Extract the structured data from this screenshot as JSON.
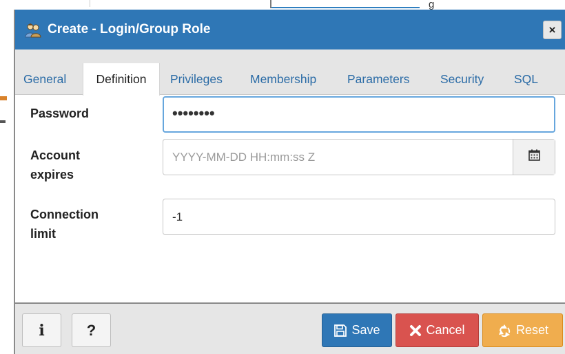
{
  "background": {
    "fragment_text": "g"
  },
  "dialog": {
    "title": "Create - Login/Group Role",
    "title_icon": "users-icon",
    "close_symbol": "×"
  },
  "tabs": [
    {
      "label": "General",
      "active": false
    },
    {
      "label": "Definition",
      "active": true
    },
    {
      "label": "Privileges",
      "active": false
    },
    {
      "label": "Membership",
      "active": false
    },
    {
      "label": "Parameters",
      "active": false
    },
    {
      "label": "Security",
      "active": false
    },
    {
      "label": "SQL",
      "active": false
    }
  ],
  "form": {
    "password": {
      "label": "Password",
      "value": "••••••••"
    },
    "account_expires": {
      "label_line1": "Account",
      "label_line2": "expires",
      "placeholder": "YYYY-MM-DD HH:mm:ss Z",
      "icon": "calendar-icon"
    },
    "connection_limit": {
      "label_line1": "Connection",
      "label_line2": "limit",
      "value": "-1"
    }
  },
  "footer": {
    "info_label": "i",
    "help_label": "?",
    "save_label": "Save",
    "cancel_label": "Cancel",
    "reset_label": "Reset"
  },
  "colors": {
    "titlebar": "#2f77b6",
    "tab_link": "#2a6ba6",
    "save": "#2f77b6",
    "cancel": "#d9534f",
    "reset": "#f0ad4e"
  }
}
